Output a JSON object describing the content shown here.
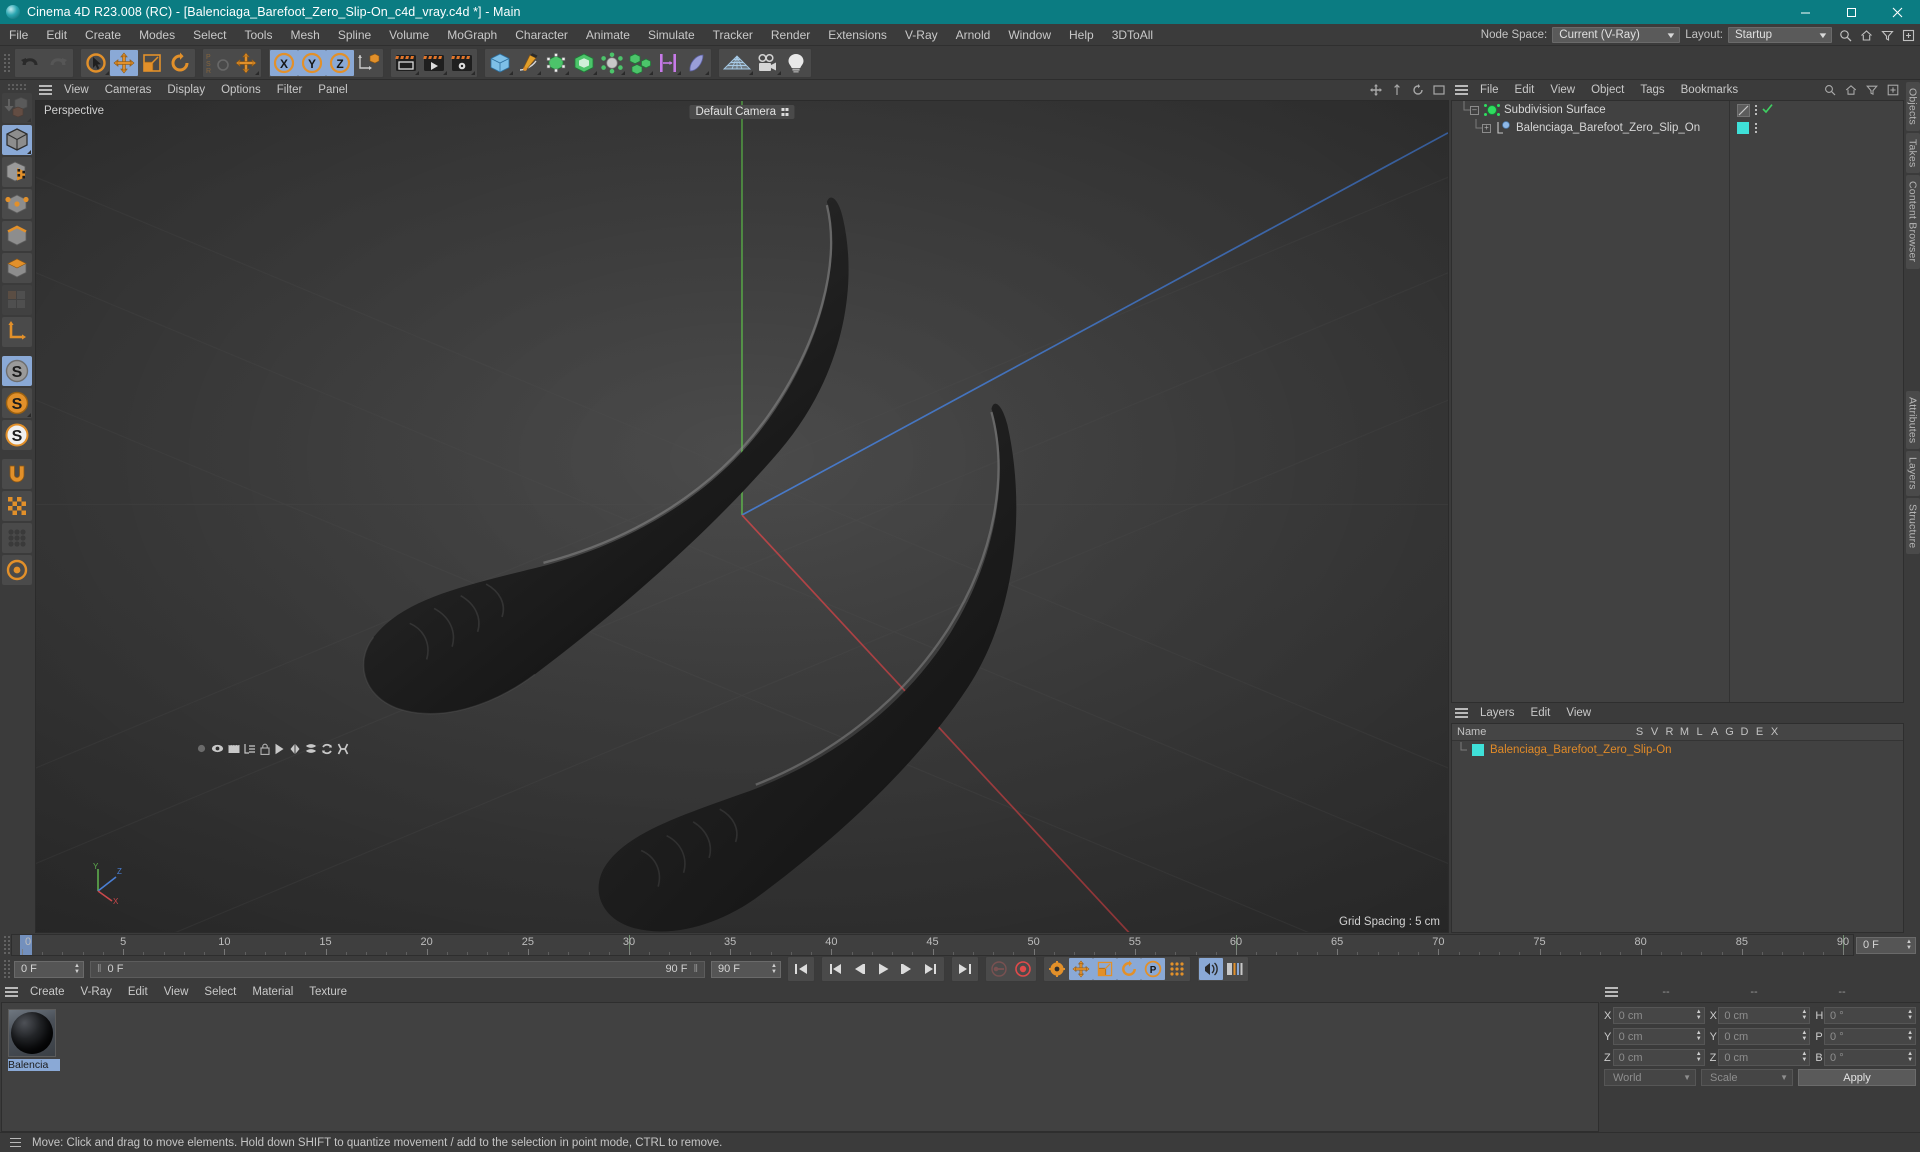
{
  "window": {
    "title": "Cinema 4D R23.008 (RC) - [Balenciaga_Barefoot_Zero_Slip-On_c4d_vray.c4d *] - Main",
    "logo_icon": "c4d-logo-icon",
    "minimize_label": "–",
    "maximize_label": "❐",
    "close_label": "✕",
    "titlebar_color": "#0b7c82"
  },
  "menubar": {
    "items": [
      {
        "label": "File"
      },
      {
        "label": "Edit"
      },
      {
        "label": "Create"
      },
      {
        "label": "Modes"
      },
      {
        "label": "Select"
      },
      {
        "label": "Tools"
      },
      {
        "label": "Mesh"
      },
      {
        "label": "Spline"
      },
      {
        "label": "Volume"
      },
      {
        "label": "MoGraph"
      },
      {
        "label": "Character"
      },
      {
        "label": "Animate"
      },
      {
        "label": "Simulate"
      },
      {
        "label": "Tracker"
      },
      {
        "label": "Render"
      },
      {
        "label": "Extensions"
      },
      {
        "label": "V-Ray"
      },
      {
        "label": "Arnold"
      },
      {
        "label": "Window"
      },
      {
        "label": "Help"
      },
      {
        "label": "3DToAll"
      }
    ],
    "node_space_label": "Node Space:",
    "node_space_value": "Current (V-Ray)",
    "layout_label": "Layout:",
    "layout_value": "Startup"
  },
  "toolbar": {
    "groups": [
      {
        "name": "history",
        "buttons": [
          {
            "name": "undo-button",
            "icon": "undo-icon",
            "state": "normal"
          },
          {
            "name": "redo-button",
            "icon": "redo-icon",
            "state": "disabled"
          }
        ]
      },
      {
        "name": "transform",
        "buttons": [
          {
            "name": "select-tool-button",
            "icon": "cursor-select-icon",
            "state": "normal"
          },
          {
            "name": "move-tool-button",
            "icon": "move-icon",
            "state": "selected"
          },
          {
            "name": "scale-tool-button",
            "icon": "scale-icon",
            "state": "normal"
          },
          {
            "name": "rotate-tool-button",
            "icon": "rotate-icon",
            "state": "normal"
          }
        ]
      },
      {
        "name": "psr",
        "buttons": [
          {
            "name": "psr-lock-button",
            "icon": "psr-icon",
            "state": "disabled"
          },
          {
            "name": "world-object-axis-button",
            "icon": "move-axis-icon",
            "state": "normal"
          }
        ]
      },
      {
        "name": "axes",
        "buttons": [
          {
            "name": "x-axis-button",
            "icon": "x-axis-icon",
            "state": "selected"
          },
          {
            "name": "y-axis-button",
            "icon": "y-axis-icon",
            "state": "selected"
          },
          {
            "name": "z-axis-button",
            "icon": "z-axis-icon",
            "state": "selected"
          },
          {
            "name": "world-coordinate-button",
            "icon": "world-axis-icon",
            "state": "normal"
          }
        ]
      },
      {
        "name": "render",
        "buttons": [
          {
            "name": "render-view-button",
            "icon": "render-view-icon",
            "state": "normal"
          },
          {
            "name": "render-to-picture-button",
            "icon": "render-picture-icon",
            "state": "normal"
          },
          {
            "name": "render-settings-button",
            "icon": "render-settings-icon",
            "state": "normal"
          }
        ]
      },
      {
        "name": "objects",
        "buttons": [
          {
            "name": "add-cube-button",
            "icon": "cube-icon",
            "state": "normal"
          },
          {
            "name": "add-spline-button",
            "icon": "pen-spline-icon",
            "state": "normal"
          },
          {
            "name": "generators-button",
            "icon": "subdivision-icon",
            "state": "normal"
          },
          {
            "name": "deformers-button",
            "icon": "bend-deformer-icon",
            "state": "normal"
          },
          {
            "name": "scene-objects-button",
            "icon": "environment-icon",
            "state": "normal"
          },
          {
            "name": "mograph-button",
            "icon": "cloner-icon",
            "state": "normal"
          },
          {
            "name": "field-button",
            "icon": "field-icon",
            "state": "normal"
          },
          {
            "name": "character-button",
            "icon": "character-icon",
            "state": "normal"
          }
        ]
      },
      {
        "name": "view",
        "buttons": [
          {
            "name": "floor-grid-button",
            "icon": "floor-icon",
            "state": "normal"
          },
          {
            "name": "camera-button",
            "icon": "camera-icon",
            "state": "normal"
          },
          {
            "name": "light-button",
            "icon": "light-bulb-icon",
            "state": "normal"
          }
        ]
      }
    ]
  },
  "left_toolbar": {
    "buttons": [
      {
        "name": "make-editable-button",
        "icon": "make-editable-icon",
        "state": "disabled"
      },
      {
        "name": "model-mode-button",
        "icon": "model-mode-icon",
        "state": "selected"
      },
      {
        "name": "texture-mode-button",
        "icon": "texture-mode-icon",
        "state": "normal"
      },
      {
        "name": "point-mode-button",
        "icon": "point-mode-icon",
        "state": "normal"
      },
      {
        "name": "edge-mode-button",
        "icon": "edge-mode-icon",
        "state": "normal"
      },
      {
        "name": "polygon-mode-button",
        "icon": "polygon-mode-icon",
        "state": "normal"
      },
      {
        "name": "uv-mode-button",
        "icon": "uv-mode-icon",
        "state": "disabled"
      },
      {
        "name": "axis-mode-button",
        "icon": "axis-mode-icon",
        "state": "normal"
      },
      {
        "name": "enable-axis-button",
        "icon": "s-gray-icon",
        "state": "selected"
      },
      {
        "name": "enable-snap-button",
        "icon": "s-orange-icon",
        "state": "normal"
      },
      {
        "name": "workplane-button",
        "icon": "s-white-icon",
        "state": "normal"
      },
      {
        "name": "magnet-button",
        "icon": "magnet-icon",
        "state": "normal"
      },
      {
        "name": "viewport-solo-button",
        "icon": "checker-icon",
        "state": "normal"
      },
      {
        "name": "viewport-filter-button",
        "icon": "filter-dots-icon",
        "state": "normal"
      },
      {
        "name": "interaction-tag-button",
        "icon": "circle-arrow-icon",
        "state": "normal"
      }
    ]
  },
  "viewport": {
    "menu": [
      {
        "label": "View"
      },
      {
        "label": "Cameras"
      },
      {
        "label": "Display"
      },
      {
        "label": "Options"
      },
      {
        "label": "Filter"
      },
      {
        "label": "Panel"
      }
    ],
    "header_icons": [
      {
        "name": "view-move-icon"
      },
      {
        "name": "view-scale-icon"
      },
      {
        "name": "view-rotate-icon"
      },
      {
        "name": "view-maximize-icon"
      }
    ],
    "perspective_label": "Perspective",
    "camera_label": "Default Camera",
    "grid_spacing_label": "Grid Spacing : 5 cm",
    "axis_labels": {
      "x": "X",
      "y": "Y",
      "z": "Z"
    },
    "axis_colors": {
      "x": "#c9484b",
      "y": "#5eae4d",
      "z": "#4a7fd4"
    }
  },
  "object_manager": {
    "menu": [
      {
        "label": "File"
      },
      {
        "label": "Edit"
      },
      {
        "label": "View"
      },
      {
        "label": "Object"
      },
      {
        "label": "Tags"
      },
      {
        "label": "Bookmarks"
      }
    ],
    "header_icons": [
      {
        "name": "search-icon"
      },
      {
        "name": "home-icon"
      },
      {
        "name": "filter-icon"
      },
      {
        "name": "add-panel-icon"
      }
    ],
    "rows": [
      {
        "name": "Subdivision Surface",
        "icon": "subdivision-surface-icon",
        "depth": 0,
        "expander": "-",
        "tag_icon": "phong-tag-icon",
        "enabled_icon": "check-icon",
        "selected": false
      },
      {
        "name": "Balenciaga_Barefoot_Zero_Slip_On",
        "icon": "polygon-object-icon",
        "depth": 1,
        "expander": "+",
        "tag_icon": "layer-color-tag",
        "tag_color": "#3fe0d8",
        "selected": false
      }
    ]
  },
  "layer_manager": {
    "menu": [
      {
        "label": "Layers"
      },
      {
        "label": "Edit"
      },
      {
        "label": "View"
      }
    ],
    "columns": [
      "Name",
      "S",
      "V",
      "R",
      "M",
      "L",
      "A",
      "G",
      "D",
      "E",
      "X"
    ],
    "rows": [
      {
        "name": "Balenciaga_Barefoot_Zero_Slip-On",
        "color": "#3fe0d8",
        "text_color": "#e08a28",
        "icons": [
          "solo-dot-icon",
          "eye-icon",
          "render-icon",
          "manager-icon",
          "lock-icon",
          "animation-icon",
          "generator-icon",
          "deformer-icon",
          "expression-icon",
          "xref-icon"
        ]
      }
    ]
  },
  "right_tabs": [
    {
      "label": "Objects"
    },
    {
      "label": "Takes"
    },
    {
      "label": "Content Browser"
    },
    {
      "label": "Attributes"
    },
    {
      "label": "Layers"
    },
    {
      "label": "Structure"
    }
  ],
  "timeline": {
    "start_frame_value": "0 F",
    "start_frame_readonly": "0 F",
    "end_frame_value": "90 F",
    "end_frame_readonly": "90 F",
    "current_frame_value": "0 F",
    "ruler_min": 0,
    "ruler_max": 90,
    "ruler_labels": [
      "0",
      "5",
      "10",
      "15",
      "20",
      "25",
      "30",
      "35",
      "40",
      "45",
      "50",
      "55",
      "60",
      "65",
      "70",
      "75",
      "80",
      "85",
      "90"
    ],
    "playhead_frame": 0,
    "green_markers": [
      30,
      60,
      90
    ],
    "transport_buttons": [
      {
        "name": "go-to-start-button",
        "icon": "skip-start-icon"
      },
      {
        "name": "previous-key-button",
        "icon": "prev-key-icon"
      },
      {
        "name": "step-back-button",
        "icon": "step-back-icon"
      },
      {
        "name": "play-button",
        "icon": "play-icon"
      },
      {
        "name": "step-forward-button",
        "icon": "step-forward-icon"
      },
      {
        "name": "next-key-button",
        "icon": "next-key-icon"
      },
      {
        "name": "go-to-end-button",
        "icon": "skip-end-icon"
      }
    ],
    "record_buttons": [
      {
        "name": "autokey-button",
        "icon": "key-icon",
        "state": "disabled"
      },
      {
        "name": "record-button",
        "icon": "record-icon",
        "state": "normal"
      },
      {
        "name": "keyframe-settings-button",
        "icon": "gear-key-icon",
        "state": "normal"
      },
      {
        "name": "record-position-button",
        "icon": "move-icon",
        "state": "selected"
      },
      {
        "name": "record-scale-button",
        "icon": "scale-icon",
        "state": "selected"
      },
      {
        "name": "record-rotation-button",
        "icon": "rotate-icon",
        "state": "selected"
      },
      {
        "name": "record-param-button",
        "icon": "p-circle-icon",
        "state": "selected"
      },
      {
        "name": "record-pla-button",
        "icon": "point-level-icon",
        "state": "normal"
      },
      {
        "name": "sound-button",
        "icon": "sound-icon",
        "state": "selected"
      },
      {
        "name": "timeline-settings-button",
        "icon": "timeline-bars-icon",
        "state": "normal"
      }
    ]
  },
  "material_manager": {
    "menu": [
      {
        "label": "Create"
      },
      {
        "label": "V-Ray"
      },
      {
        "label": "Edit"
      },
      {
        "label": "View"
      },
      {
        "label": "Select"
      },
      {
        "label": "Material"
      },
      {
        "label": "Texture"
      }
    ],
    "materials": [
      {
        "name": "Balencia",
        "full_name": "Balenciaga",
        "selected": true,
        "icon": "material-sphere-icon"
      }
    ]
  },
  "coordinates": {
    "header_cols": [
      "--",
      "--",
      "--"
    ],
    "position": {
      "label_x": "X",
      "label_y": "Y",
      "label_z": "Z",
      "x": "0 cm",
      "y": "0 cm",
      "z": "0 cm"
    },
    "size": {
      "label_x": "X",
      "label_y": "Y",
      "label_z": "Z",
      "x": "0 cm",
      "y": "0 cm",
      "z": "0 cm"
    },
    "rotation": {
      "label_h": "H",
      "label_p": "P",
      "label_b": "B",
      "h": "0 °",
      "p": "0 °",
      "b": "0 °"
    },
    "coord_system": "World",
    "size_mode": "Scale",
    "apply_label": "Apply"
  },
  "statusbar": {
    "message": "Move: Click and drag to move elements. Hold down SHIFT to quantize movement / add to the selection in point mode, CTRL to remove."
  }
}
